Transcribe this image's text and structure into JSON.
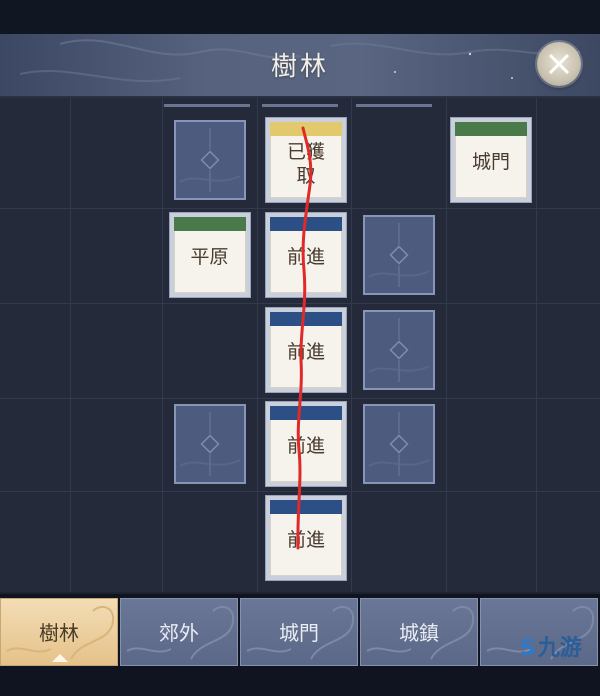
{
  "window": {
    "title": "樹林"
  },
  "board": {
    "cards": [
      {
        "label_lines": [
          "已獲",
          "取"
        ],
        "band": "yellow",
        "col": 3,
        "row": 0
      },
      {
        "label_lines": [
          "城門"
        ],
        "band": "green",
        "col": 5,
        "row": 0
      },
      {
        "label_lines": [
          "平原"
        ],
        "band": "green",
        "col": 2,
        "row": 1
      },
      {
        "label_lines": [
          "前進"
        ],
        "band": "blue",
        "col": 3,
        "row": 1
      },
      {
        "label_lines": [
          "前進"
        ],
        "band": "blue",
        "col": 3,
        "row": 2
      },
      {
        "label_lines": [
          "前進"
        ],
        "band": "blue",
        "col": 3,
        "row": 3
      },
      {
        "label_lines": [
          "前進"
        ],
        "band": "blue",
        "col": 3,
        "row": 4
      }
    ],
    "hidden_tiles": [
      {
        "col": 2,
        "row": 0
      },
      {
        "col": 4,
        "row": 1
      },
      {
        "col": 4,
        "row": 2
      },
      {
        "col": 2,
        "row": 3
      },
      {
        "col": 4,
        "row": 3
      }
    ]
  },
  "tabs": [
    {
      "label": "樹林",
      "active": true
    },
    {
      "label": "郊外",
      "active": false
    },
    {
      "label": "城門",
      "active": false
    },
    {
      "label": "城鎮",
      "active": false
    },
    {
      "label": "",
      "active": false
    }
  ],
  "watermark": {
    "text": "九游",
    "icon": "s-swirl-logo-icon"
  },
  "colors": {
    "band_blue": "#2c4f86",
    "band_green": "#4b7a4a",
    "band_yellow": "#e2c96d",
    "tab_active": "#e5c28a",
    "annotation_red": "#e02a2a"
  }
}
